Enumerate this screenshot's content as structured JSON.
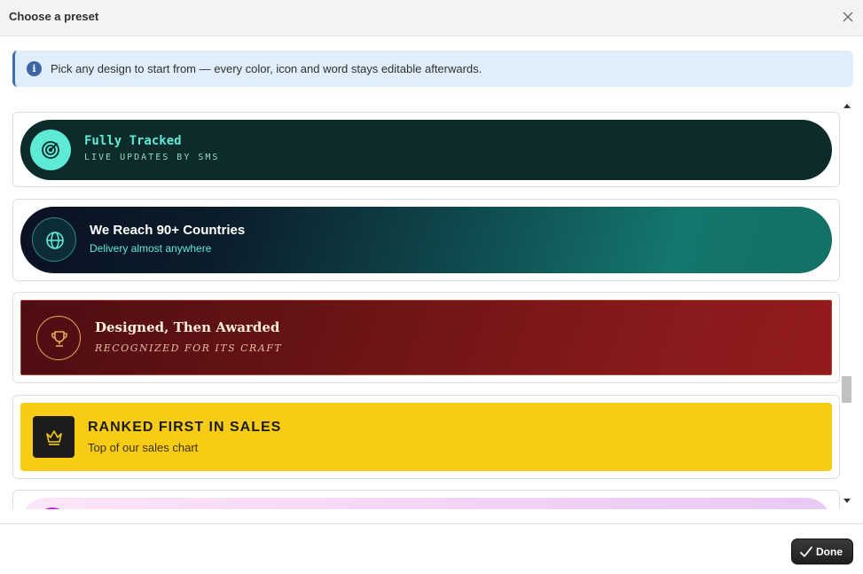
{
  "header": {
    "title": "Choose a preset",
    "close_icon": "close-icon"
  },
  "banner": {
    "icon": "info-icon",
    "icon_glyph": "i",
    "text": "Pick any design to start from — every color, icon and word stays editable afterwards."
  },
  "presets": [
    {
      "title": "Fully Tracked",
      "subtitle": "LIVE UPDATES BY SMS",
      "icon": "radar-icon",
      "bg": "#0d2b2b",
      "accent": "#5eead4"
    },
    {
      "title": "We Reach 90+ Countries",
      "subtitle": "Delivery almost anywhere",
      "icon": "globe-icon",
      "bg": "#0b1d2a",
      "accent": "#5eead4"
    },
    {
      "title": "Designed, Then Awarded",
      "subtitle": "RECOGNIZED FOR ITS CRAFT",
      "icon": "trophy-icon",
      "bg": "#6a1416",
      "accent": "#e8a85a"
    },
    {
      "title": "RANKED FIRST IN SALES",
      "subtitle": "Top of our sales chart",
      "icon": "crown-icon",
      "bg": "#f8cb15",
      "accent": "#1c1c1c"
    },
    {
      "title": "",
      "subtitle": "",
      "icon": "badge-icon",
      "bg": "#f2d2f4",
      "accent": "#c026d3"
    }
  ],
  "footer": {
    "done_label": "Done",
    "done_icon": "checkmark-icon"
  }
}
